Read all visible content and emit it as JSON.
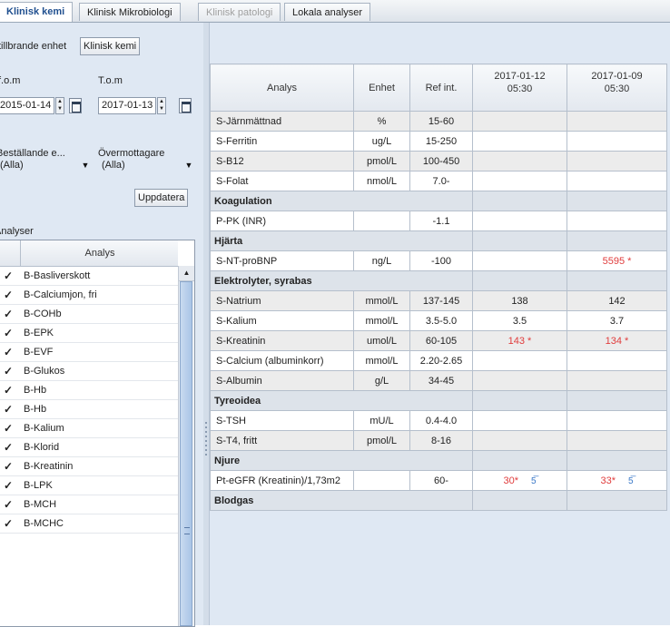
{
  "tabs": [
    {
      "label": "Klinisk kemi",
      "state": "active"
    },
    {
      "label": "Klinisk Mikrobiologi",
      "state": "normal"
    },
    {
      "label": "Klinisk patologi",
      "state": "disabled"
    },
    {
      "label": "Lokala analyser",
      "state": "normal"
    }
  ],
  "left": {
    "unit_label": "tillbrande enhet",
    "unit_button": "Klinisk kemi",
    "from_label": "f.o.m",
    "from_date": "2015-01-14",
    "to_label": "T.o.m",
    "to_date": "2017-01-13",
    "requester_label": "Beställande e...",
    "requester_value": "(Alla)",
    "receiver_label": "Övermottagare",
    "receiver_value": "(Alla)",
    "update_button": "Uppdatera",
    "group_label": "Analyser",
    "list_header": "Analys",
    "items": [
      "B-Basliverskott",
      "B-Calciumjon, fri",
      "B-COHb",
      "B-EPK",
      "B-EVF",
      "B-Glukos",
      "B-Hb",
      "B-Hb",
      "B-Kalium",
      "B-Klorid",
      "B-Kreatinin",
      "B-LPK",
      "B-MCH",
      "B-MCHC"
    ],
    "check_glyph": "✓"
  },
  "grid": {
    "headers": {
      "analys": "Analys",
      "enhet": "Enhet",
      "ref": "Ref int."
    },
    "dates": [
      {
        "date": "2017-01-12",
        "time": "05:30"
      },
      {
        "date": "2017-01-09",
        "time": "05:30"
      }
    ],
    "rows": [
      {
        "type": "row",
        "analys": "S-Järnmättnad",
        "enhet": "%",
        "ref": "15-60",
        "v1": "",
        "v2": "",
        "shade": true
      },
      {
        "type": "row",
        "analys": "S-Ferritin",
        "enhet": "ug/L",
        "ref": "15-250",
        "v1": "",
        "v2": "",
        "shade": false
      },
      {
        "type": "row",
        "analys": "S-B12",
        "enhet": "pmol/L",
        "ref": "100-450",
        "v1": "",
        "v2": "",
        "shade": true
      },
      {
        "type": "row",
        "analys": "S-Folat",
        "enhet": "nmol/L",
        "ref": "7.0-",
        "v1": "",
        "v2": "",
        "shade": false
      },
      {
        "type": "group",
        "label": "Koagulation"
      },
      {
        "type": "row",
        "analys": "P-PK (INR)",
        "enhet": "",
        "ref": "-1.1",
        "v1": "",
        "v2": "",
        "shade": false
      },
      {
        "type": "group",
        "label": "Hjärta"
      },
      {
        "type": "row",
        "analys": "S-NT-proBNP",
        "enhet": "ng/L",
        "ref": "-100",
        "v1": "",
        "v2": "5595 *",
        "v2_abn": true,
        "shade": false
      },
      {
        "type": "group",
        "label": "Elektrolyter, syrabas"
      },
      {
        "type": "row",
        "analys": "S-Natrium",
        "enhet": "mmol/L",
        "ref": "137-145",
        "v1": "138",
        "v2": "142",
        "shade": true
      },
      {
        "type": "row",
        "analys": "S-Kalium",
        "enhet": "mmol/L",
        "ref": "3.5-5.0",
        "v1": "3.5",
        "v2": "3.7",
        "shade": false
      },
      {
        "type": "row",
        "analys": "S-Kreatinin",
        "enhet": "umol/L",
        "ref": "60-105",
        "v1": "143 *",
        "v1_abn": true,
        "v2": "134 *",
        "v2_abn": true,
        "shade": true
      },
      {
        "type": "row",
        "analys": "S-Calcium (albuminkorr)",
        "enhet": "mmol/L",
        "ref": "2.20-2.65",
        "v1": "",
        "v2": "",
        "shade": false
      },
      {
        "type": "row",
        "analys": "S-Albumin",
        "enhet": "g/L",
        "ref": "34-45",
        "v1": "",
        "v2": "",
        "shade": true
      },
      {
        "type": "group",
        "label": "Tyreoidea"
      },
      {
        "type": "row",
        "analys": "S-TSH",
        "enhet": "mU/L",
        "ref": "0.4-4.0",
        "v1": "",
        "v2": "",
        "shade": false
      },
      {
        "type": "row",
        "analys": "S-T4, fritt",
        "enhet": "pmol/L",
        "ref": "8-16",
        "v1": "",
        "v2": "",
        "shade": true
      },
      {
        "type": "group",
        "label": "Njure"
      },
      {
        "type": "row",
        "analys": "Pt-eGFR (Kreatinin)/1,73m2",
        "enhet": "",
        "ref": "60-",
        "v1": "30*",
        "v1_abn": true,
        "v1_icon": true,
        "v2": "33*",
        "v2_abn": true,
        "v2_icon": true,
        "shade": false
      },
      {
        "type": "group",
        "label": "Blodgas"
      }
    ]
  },
  "colors": {
    "abnormal": "#e03c3c",
    "accent": "#1f4f8f",
    "panel": "#dfe8f3"
  },
  "icons": {
    "chart": "chart-icon",
    "calendar": "calendar-icon"
  }
}
